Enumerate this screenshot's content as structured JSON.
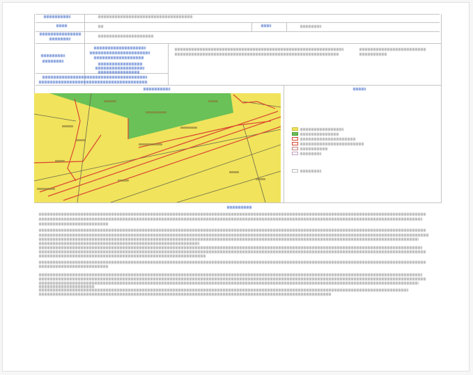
{
  "colors": {
    "label_blue": "#5b7fd1",
    "text_gray": "#7d7d7d",
    "rule": "#c4c4c4",
    "map_yellow": "#f1e35c",
    "map_green": "#69c157",
    "map_red": "#d9462f",
    "map_parcel": "#6a6a4a"
  },
  "legend_swatches": [
    {
      "fill": "#f1e35c",
      "stroke": "#c9bd3c"
    },
    {
      "fill": "#69c157",
      "stroke": "#4a9a3c"
    },
    {
      "fill": "#ffffff",
      "stroke": "#d9462f"
    },
    {
      "fill": "#ffffff",
      "stroke": "#d9462f"
    },
    {
      "fill": "#ffffff",
      "stroke": "#c08080"
    },
    {
      "fill": "#ffffff",
      "stroke": "#c0a0c0"
    },
    {
      "fill": "#ffffff",
      "stroke": "#bbbbbb"
    }
  ]
}
